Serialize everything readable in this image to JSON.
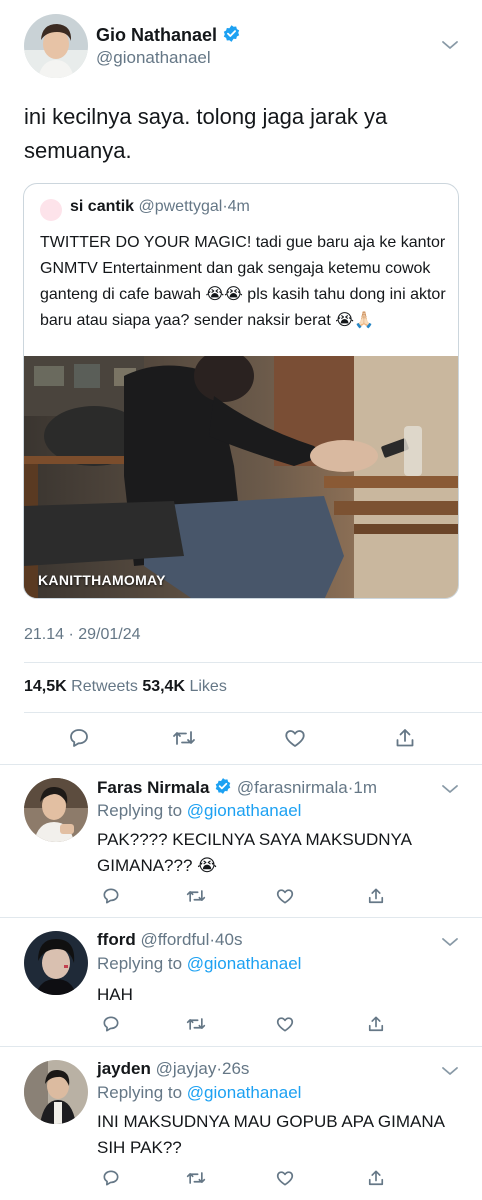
{
  "main_tweet": {
    "name": "Gio Nathanael",
    "handle": "@gionathanael",
    "text": "ini kecilnya saya. tolong jaga jarak ya semuanya.",
    "timestamp": "21.14 · 29/01/24",
    "retweets_count": "14,5K",
    "retweets_label": "Retweets",
    "likes_count": "53,4K",
    "likes_label": "Likes"
  },
  "quoted_tweet": {
    "name": "si cantik",
    "handle": "@pwettygal",
    "time": "4m",
    "text": "TWITTER DO YOUR MAGIC! tadi gue baru aja ke kantor GNMTV Entertainment dan gak sengaja ketemu cowok ganteng di cafe bawah 😭😭 pls kasih tahu dong ini aktor baru atau siapa yaa? sender naksir berat 😭🙏🏻",
    "watermark": "KANITTHAMOMAY"
  },
  "replying_to_label": "Replying to",
  "replies": [
    {
      "name": "Faras Nirmala",
      "handle": "@farasnirmala",
      "time": "1m",
      "verified": true,
      "replying_to": "@gionathanael",
      "text": "PAK???? KECILNYA SAYA MAKSUDNYA GIMANA??? 😭"
    },
    {
      "name": "fford",
      "handle": "@ffordful",
      "time": "40s",
      "verified": false,
      "replying_to": "@gionathanael",
      "text": "HAH"
    },
    {
      "name": "jayden",
      "handle": "@jayjay",
      "time": "26s",
      "verified": false,
      "replying_to": "@gionathanael",
      "text": "INI MAKSUDNYA MAU GOPUB APA GIMANA SIH PAK??"
    }
  ],
  "colors": {
    "accent": "#1da1f2",
    "text": "#14171a",
    "muted": "#657786",
    "border": "#e1e8ed"
  },
  "icons": [
    "verified-badge-icon",
    "chevron-down-icon",
    "reply-icon",
    "retweet-icon",
    "like-icon",
    "share-icon"
  ]
}
